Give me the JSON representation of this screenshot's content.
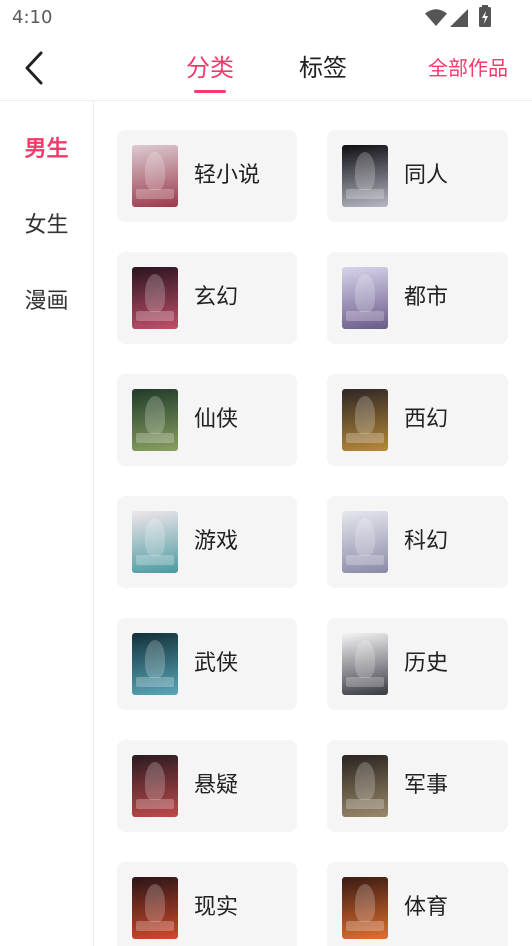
{
  "status_bar": {
    "time": "4:10",
    "icons": [
      "wifi-icon",
      "signal-icon",
      "battery-icon"
    ]
  },
  "header": {
    "back_icon": "chevron-left-icon",
    "tabs": [
      {
        "label": "分类",
        "active": true
      },
      {
        "label": "标签",
        "active": false
      }
    ],
    "all_works_label": "全部作品"
  },
  "sidebar": {
    "items": [
      {
        "label": "男生",
        "active": true
      },
      {
        "label": "女生",
        "active": false
      },
      {
        "label": "漫画",
        "active": false
      }
    ]
  },
  "categories": [
    {
      "label": "轻小说",
      "cover_colors": [
        "#dccbd3",
        "#9a3a4a"
      ]
    },
    {
      "label": "同人",
      "cover_colors": [
        "#0e0e12",
        "#b8b8c6"
      ]
    },
    {
      "label": "玄幻",
      "cover_colors": [
        "#2a1420",
        "#c0506a"
      ]
    },
    {
      "label": "都市",
      "cover_colors": [
        "#d8d4ec",
        "#6a5a8a"
      ]
    },
    {
      "label": "仙侠",
      "cover_colors": [
        "#1f3a2a",
        "#8aa060"
      ]
    },
    {
      "label": "西幻",
      "cover_colors": [
        "#2e2624",
        "#b88a3a"
      ]
    },
    {
      "label": "游戏",
      "cover_colors": [
        "#efe6ea",
        "#4a9aa0"
      ]
    },
    {
      "label": "科幻",
      "cover_colors": [
        "#e6e6ee",
        "#8a8aa8"
      ]
    },
    {
      "label": "武侠",
      "cover_colors": [
        "#12303a",
        "#5aa8b8"
      ]
    },
    {
      "label": "历史",
      "cover_colors": [
        "#f4f4f4",
        "#3a3a44"
      ]
    },
    {
      "label": "悬疑",
      "cover_colors": [
        "#2a1a22",
        "#c04a4a"
      ]
    },
    {
      "label": "军事",
      "cover_colors": [
        "#2a2420",
        "#9a8a6a"
      ]
    },
    {
      "label": "现实",
      "cover_colors": [
        "#2a1418",
        "#d04a2a"
      ]
    },
    {
      "label": "体育",
      "cover_colors": [
        "#3a1a12",
        "#e07030"
      ]
    }
  ],
  "colors": {
    "accent": "#f23a6b",
    "text": "#222222",
    "card_background": "#f5f5f5",
    "divider": "#eeeeee"
  }
}
